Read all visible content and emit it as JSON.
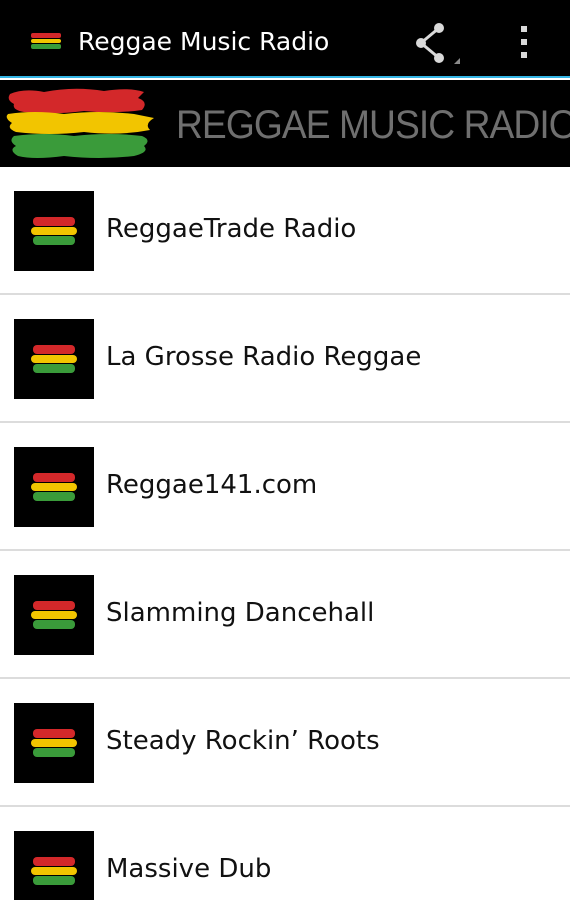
{
  "action_bar": {
    "title": "Reggae Music Radio",
    "app_icon": "rasta-flag-icon",
    "actions": [
      {
        "icon": "share-icon"
      },
      {
        "icon": "overflow-menu-icon"
      }
    ]
  },
  "banner": {
    "text": "REGGAE MUSIC RADIO",
    "logo": "rasta-flag-brush-icon"
  },
  "colors": {
    "accent": "#33b5e5",
    "flag_red": "#d3282a",
    "flag_yellow": "#f2c500",
    "flag_green": "#3a9b3a"
  },
  "stations": [
    {
      "name": "ReggaeTrade Radio",
      "icon": "rasta-flag-icon"
    },
    {
      "name": "La Grosse Radio Reggae",
      "icon": "rasta-flag-icon"
    },
    {
      "name": "Reggae141.com",
      "icon": "rasta-flag-icon"
    },
    {
      "name": "Slamming Dancehall",
      "icon": "rasta-flag-icon"
    },
    {
      "name": "Steady Rockin’ Roots",
      "icon": "rasta-flag-icon"
    },
    {
      "name": "Massive Dub",
      "icon": "rasta-flag-icon"
    }
  ]
}
